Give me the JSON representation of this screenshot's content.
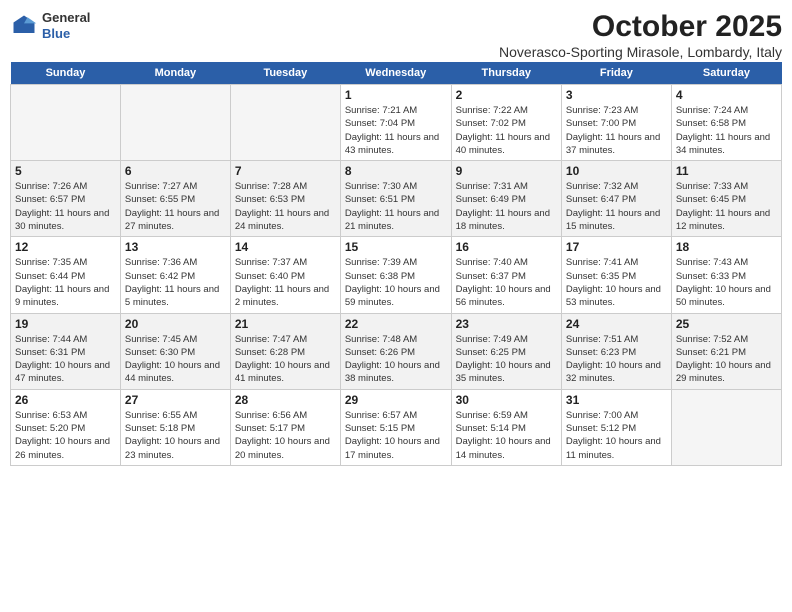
{
  "header": {
    "logo_line1": "General",
    "logo_line2": "Blue",
    "title": "October 2025",
    "subtitle": "Noverasco-Sporting Mirasole, Lombardy, Italy"
  },
  "days_of_week": [
    "Sunday",
    "Monday",
    "Tuesday",
    "Wednesday",
    "Thursday",
    "Friday",
    "Saturday"
  ],
  "weeks": [
    [
      {
        "date": "",
        "text": ""
      },
      {
        "date": "",
        "text": ""
      },
      {
        "date": "",
        "text": ""
      },
      {
        "date": "1",
        "text": "Sunrise: 7:21 AM\nSunset: 7:04 PM\nDaylight: 11 hours and 43 minutes."
      },
      {
        "date": "2",
        "text": "Sunrise: 7:22 AM\nSunset: 7:02 PM\nDaylight: 11 hours and 40 minutes."
      },
      {
        "date": "3",
        "text": "Sunrise: 7:23 AM\nSunset: 7:00 PM\nDaylight: 11 hours and 37 minutes."
      },
      {
        "date": "4",
        "text": "Sunrise: 7:24 AM\nSunset: 6:58 PM\nDaylight: 11 hours and 34 minutes."
      }
    ],
    [
      {
        "date": "5",
        "text": "Sunrise: 7:26 AM\nSunset: 6:57 PM\nDaylight: 11 hours and 30 minutes."
      },
      {
        "date": "6",
        "text": "Sunrise: 7:27 AM\nSunset: 6:55 PM\nDaylight: 11 hours and 27 minutes."
      },
      {
        "date": "7",
        "text": "Sunrise: 7:28 AM\nSunset: 6:53 PM\nDaylight: 11 hours and 24 minutes."
      },
      {
        "date": "8",
        "text": "Sunrise: 7:30 AM\nSunset: 6:51 PM\nDaylight: 11 hours and 21 minutes."
      },
      {
        "date": "9",
        "text": "Sunrise: 7:31 AM\nSunset: 6:49 PM\nDaylight: 11 hours and 18 minutes."
      },
      {
        "date": "10",
        "text": "Sunrise: 7:32 AM\nSunset: 6:47 PM\nDaylight: 11 hours and 15 minutes."
      },
      {
        "date": "11",
        "text": "Sunrise: 7:33 AM\nSunset: 6:45 PM\nDaylight: 11 hours and 12 minutes."
      }
    ],
    [
      {
        "date": "12",
        "text": "Sunrise: 7:35 AM\nSunset: 6:44 PM\nDaylight: 11 hours and 9 minutes."
      },
      {
        "date": "13",
        "text": "Sunrise: 7:36 AM\nSunset: 6:42 PM\nDaylight: 11 hours and 5 minutes."
      },
      {
        "date": "14",
        "text": "Sunrise: 7:37 AM\nSunset: 6:40 PM\nDaylight: 11 hours and 2 minutes."
      },
      {
        "date": "15",
        "text": "Sunrise: 7:39 AM\nSunset: 6:38 PM\nDaylight: 10 hours and 59 minutes."
      },
      {
        "date": "16",
        "text": "Sunrise: 7:40 AM\nSunset: 6:37 PM\nDaylight: 10 hours and 56 minutes."
      },
      {
        "date": "17",
        "text": "Sunrise: 7:41 AM\nSunset: 6:35 PM\nDaylight: 10 hours and 53 minutes."
      },
      {
        "date": "18",
        "text": "Sunrise: 7:43 AM\nSunset: 6:33 PM\nDaylight: 10 hours and 50 minutes."
      }
    ],
    [
      {
        "date": "19",
        "text": "Sunrise: 7:44 AM\nSunset: 6:31 PM\nDaylight: 10 hours and 47 minutes."
      },
      {
        "date": "20",
        "text": "Sunrise: 7:45 AM\nSunset: 6:30 PM\nDaylight: 10 hours and 44 minutes."
      },
      {
        "date": "21",
        "text": "Sunrise: 7:47 AM\nSunset: 6:28 PM\nDaylight: 10 hours and 41 minutes."
      },
      {
        "date": "22",
        "text": "Sunrise: 7:48 AM\nSunset: 6:26 PM\nDaylight: 10 hours and 38 minutes."
      },
      {
        "date": "23",
        "text": "Sunrise: 7:49 AM\nSunset: 6:25 PM\nDaylight: 10 hours and 35 minutes."
      },
      {
        "date": "24",
        "text": "Sunrise: 7:51 AM\nSunset: 6:23 PM\nDaylight: 10 hours and 32 minutes."
      },
      {
        "date": "25",
        "text": "Sunrise: 7:52 AM\nSunset: 6:21 PM\nDaylight: 10 hours and 29 minutes."
      }
    ],
    [
      {
        "date": "26",
        "text": "Sunrise: 6:53 AM\nSunset: 5:20 PM\nDaylight: 10 hours and 26 minutes."
      },
      {
        "date": "27",
        "text": "Sunrise: 6:55 AM\nSunset: 5:18 PM\nDaylight: 10 hours and 23 minutes."
      },
      {
        "date": "28",
        "text": "Sunrise: 6:56 AM\nSunset: 5:17 PM\nDaylight: 10 hours and 20 minutes."
      },
      {
        "date": "29",
        "text": "Sunrise: 6:57 AM\nSunset: 5:15 PM\nDaylight: 10 hours and 17 minutes."
      },
      {
        "date": "30",
        "text": "Sunrise: 6:59 AM\nSunset: 5:14 PM\nDaylight: 10 hours and 14 minutes."
      },
      {
        "date": "31",
        "text": "Sunrise: 7:00 AM\nSunset: 5:12 PM\nDaylight: 10 hours and 11 minutes."
      },
      {
        "date": "",
        "text": ""
      }
    ]
  ]
}
